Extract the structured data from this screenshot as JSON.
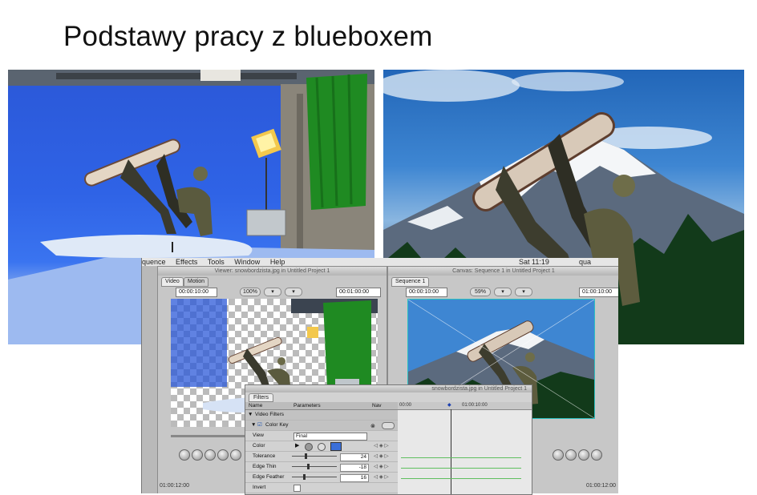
{
  "slide": {
    "title": "Podstawy pracy z blueboxem"
  },
  "menubar": {
    "items": [
      "quence",
      "Effects",
      "Tools",
      "Window",
      "Help"
    ],
    "clock": "Sat 11:19",
    "user": "qua"
  },
  "viewer": {
    "window_title": "Viewer: snowbordzista.jpg in Untitled Project 1",
    "tabs": [
      "Video",
      "Motion"
    ],
    "timecode_left": "00:00:10:00",
    "zoom": "100%",
    "timecode_right": "00:01:00:00",
    "bottom_timecode": "01:00:12:00"
  },
  "canvas": {
    "window_title": "Canvas: Sequence 1 in Untitled Project 1",
    "tabs": [
      "Sequence 1"
    ],
    "timecode_left": "00:00:10:00",
    "zoom": "59%",
    "timecode_right": "01:00:10:00",
    "bottom_timecode": "01:00:12:00"
  },
  "filters": {
    "window_title": "snowbordzista.jpg in Untitled Project 1",
    "tab": "Filters",
    "col_name": "Name",
    "col_params": "Parameters",
    "col_nav": "Nav",
    "timeline_start": "00:00",
    "timeline_mark": "01:00:10:00",
    "group": "Video Filters",
    "filter": "Color Key",
    "rows": [
      {
        "label": "View",
        "value": "Final"
      },
      {
        "label": "Color",
        "value": ""
      },
      {
        "label": "Tolerance",
        "value": "24"
      },
      {
        "label": "Edge Thin",
        "value": "-18"
      },
      {
        "label": "Edge Feather",
        "value": "16"
      },
      {
        "label": "Invert",
        "value": ""
      }
    ],
    "key_color": "#3b6fd8"
  },
  "colors": {
    "bluescreen": "#2f63e6",
    "sky": "#3e86d2",
    "green_curtain": "#1f8a22"
  }
}
